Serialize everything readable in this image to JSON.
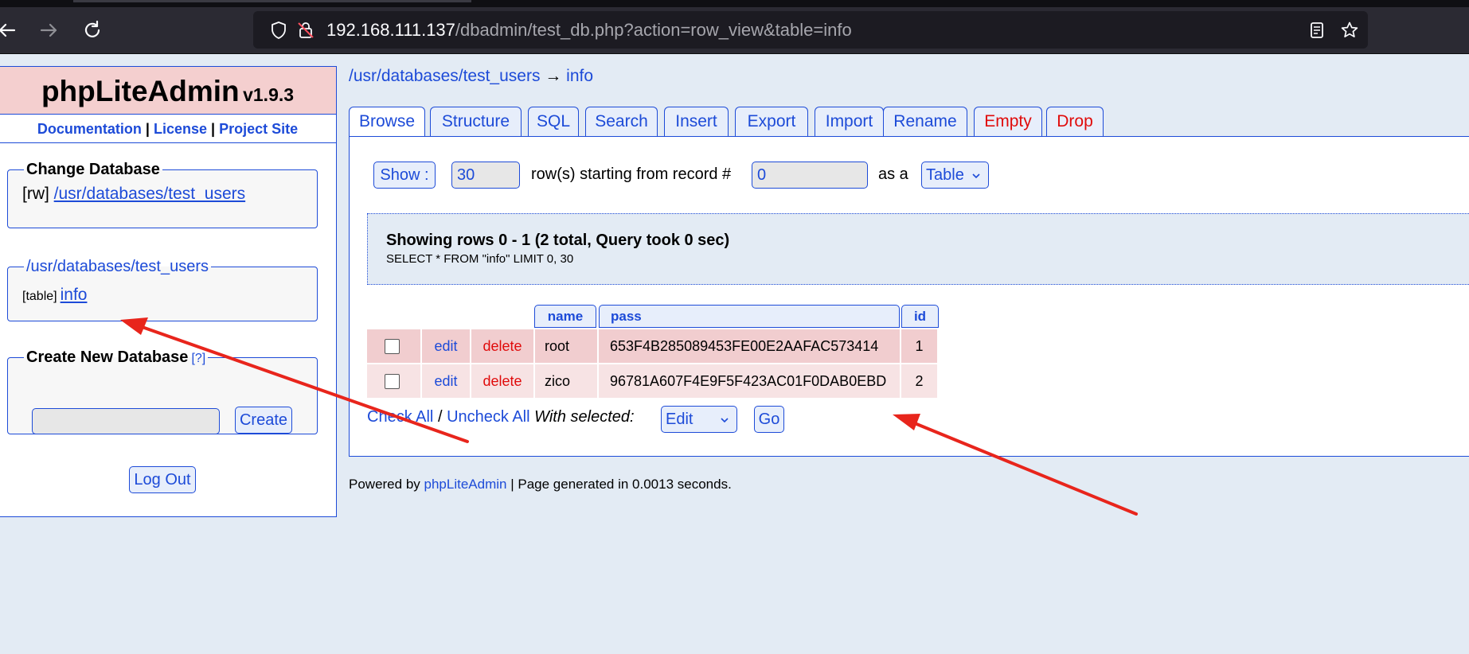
{
  "browser": {
    "url_host": "192.168.111.137",
    "url_path": "/dbadmin/test_db.php?action=row_view&table=info",
    "icons": [
      "back-icon",
      "forward-icon",
      "reload-icon",
      "shield-icon",
      "insecure-lock-icon",
      "reader-view-icon",
      "bookmark-star-icon"
    ]
  },
  "sidebar": {
    "app_name": "phpLiteAdmin",
    "version": "v1.9.3",
    "links": [
      "Documentation",
      "License",
      "Project Site"
    ],
    "link_sep": "|",
    "change_db": {
      "legend": "Change Database",
      "mode": "[rw]",
      "db_link": "/usr/databases/test_users"
    },
    "db_tables": {
      "legend": "/usr/databases/test_users",
      "type": "[table]",
      "table_link": "info"
    },
    "create_db": {
      "legend": "Create New Database",
      "help": "[?]",
      "input_value": "",
      "button": "Create"
    },
    "logout": "Log Out"
  },
  "main": {
    "breadcrumb_db": "/usr/databases/test_users",
    "breadcrumb_arrow": "→",
    "breadcrumb_table": "info",
    "tabs": [
      "Browse",
      "Structure",
      "SQL",
      "Search",
      "Insert",
      "Export",
      "Import",
      "Rename",
      "Empty",
      "Drop"
    ],
    "active_tab": "Browse",
    "controls": {
      "show_button": "Show :",
      "rows_value": "30",
      "rows_label": "row(s) starting from record #",
      "start_value": "0",
      "as_label": "as a",
      "view_select": "Table"
    },
    "result": {
      "summary": "Showing rows 0 - 1 (2 total, Query took 0 sec)",
      "query": "SELECT * FROM \"info\" LIMIT 0, 30"
    },
    "table": {
      "columns": [
        "name",
        "pass",
        "id"
      ],
      "edit_label": "edit",
      "delete_label": "delete",
      "rows": [
        {
          "name": "root",
          "pass": "653F4B285089453FE00E2AAFAC573414",
          "id": "1"
        },
        {
          "name": "zico",
          "pass": "96781A607F4E9F5F423AC01F0DAB0EBD",
          "id": "2"
        }
      ]
    },
    "bulk": {
      "check_all": "Check All",
      "sep": "/",
      "uncheck_all": "Uncheck All",
      "with_selected": "With selected:",
      "action_select": "Edit",
      "go": "Go"
    }
  },
  "footer": {
    "powered_prefix": "Powered by",
    "powered_link": "phpLiteAdmin",
    "generated": "| Page generated in 0.0013 seconds."
  },
  "colors": {
    "accent": "#1d4bd8",
    "danger": "#e00b0b",
    "annotation_arrow": "#e8251c"
  }
}
